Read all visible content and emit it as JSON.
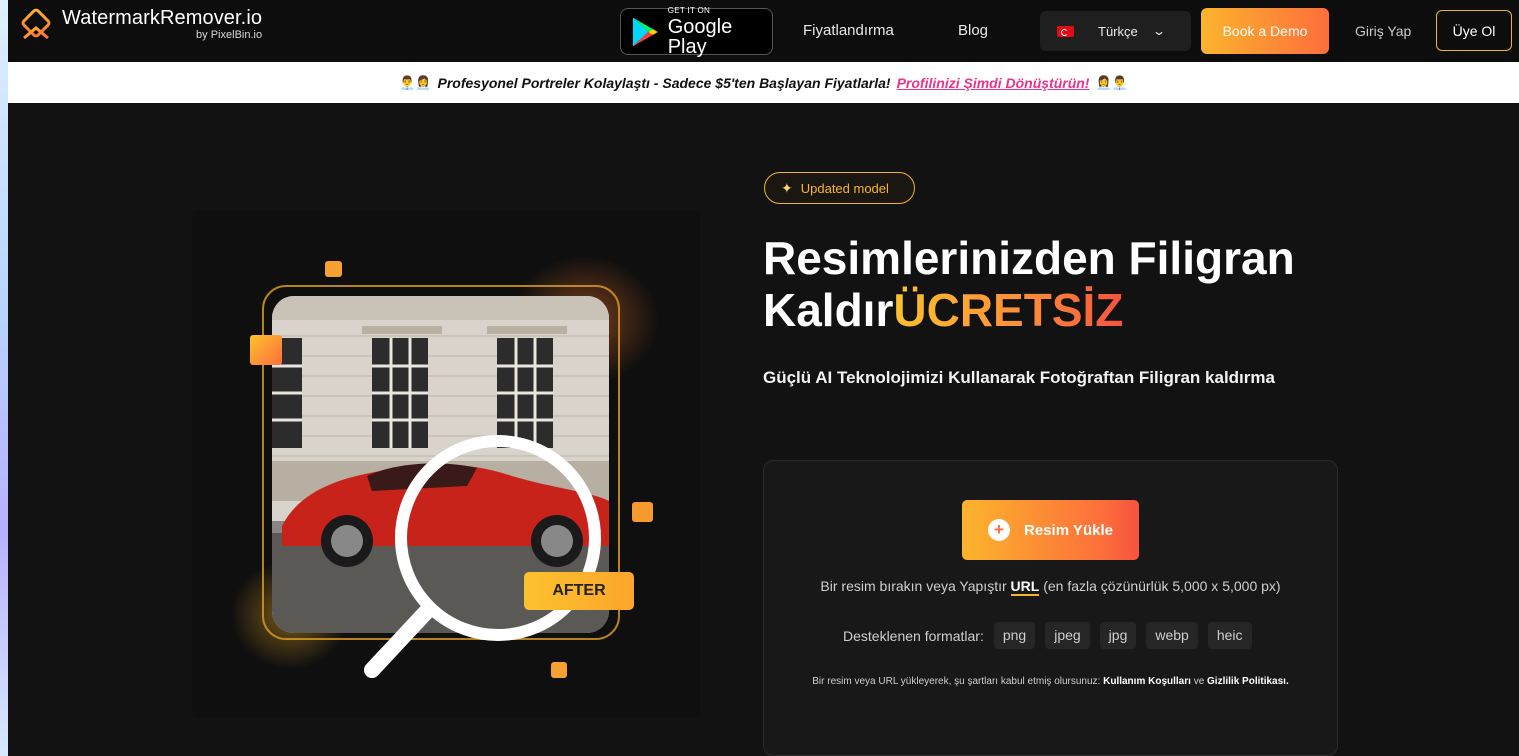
{
  "nav": {
    "logo_title": "WatermarkRemover.io",
    "logo_sub": "by PixelBin.io",
    "gplay_small": "GET IT ON",
    "gplay_big": "Google Play",
    "pricing": "Fiyatlandırma",
    "blog": "Blog",
    "language": "Türkçe",
    "book_demo": "Book a Demo",
    "login": "Giriş Yap",
    "signup": "Üye Ol"
  },
  "banner": {
    "emoji_left": "👨‍💼👩‍💼",
    "text": "Profesyonel Portreler Kolaylaştı - Sadece $5'ten Başlayan Fiyatlarla!",
    "link": "Profilinizi Şimdi Dönüştürün!",
    "emoji_right": "👩‍💼👨‍💼"
  },
  "hero": {
    "badge": "Updated model",
    "title_line1": "Resimlerinizden Filigran",
    "title_line2_plain": "Kaldır",
    "title_line2_highlight": "ÜCRETSİZ",
    "subtitle": "Güçlü AI Teknolojimizi Kullanarak Fotoğraftan Filigran kaldırma",
    "after_label": "AFTER"
  },
  "upload": {
    "button": "Resim Yükle",
    "drop_prefix": "Bir resim bırakın veya Yapıştır",
    "drop_url": "URL",
    "drop_suffix": "(en fazla çözünürlük 5,000 x 5,000 px)",
    "formats_label": "Desteklenen formatlar:",
    "formats": [
      "png",
      "jpeg",
      "jpg",
      "webp",
      "heic"
    ],
    "terms_prefix": "Bir resim veya URL yükleyerek, şu şartları kabul etmiş olursunuz:",
    "terms_link1": "Kullanım Koşulları",
    "terms_mid": "ve",
    "terms_link2": "Gizlilik Politikası."
  },
  "colors": {
    "accent_yellow": "#fcb42d",
    "accent_orange": "#fd6e3b",
    "banner_link": "#e8348c",
    "background": "#121212"
  }
}
